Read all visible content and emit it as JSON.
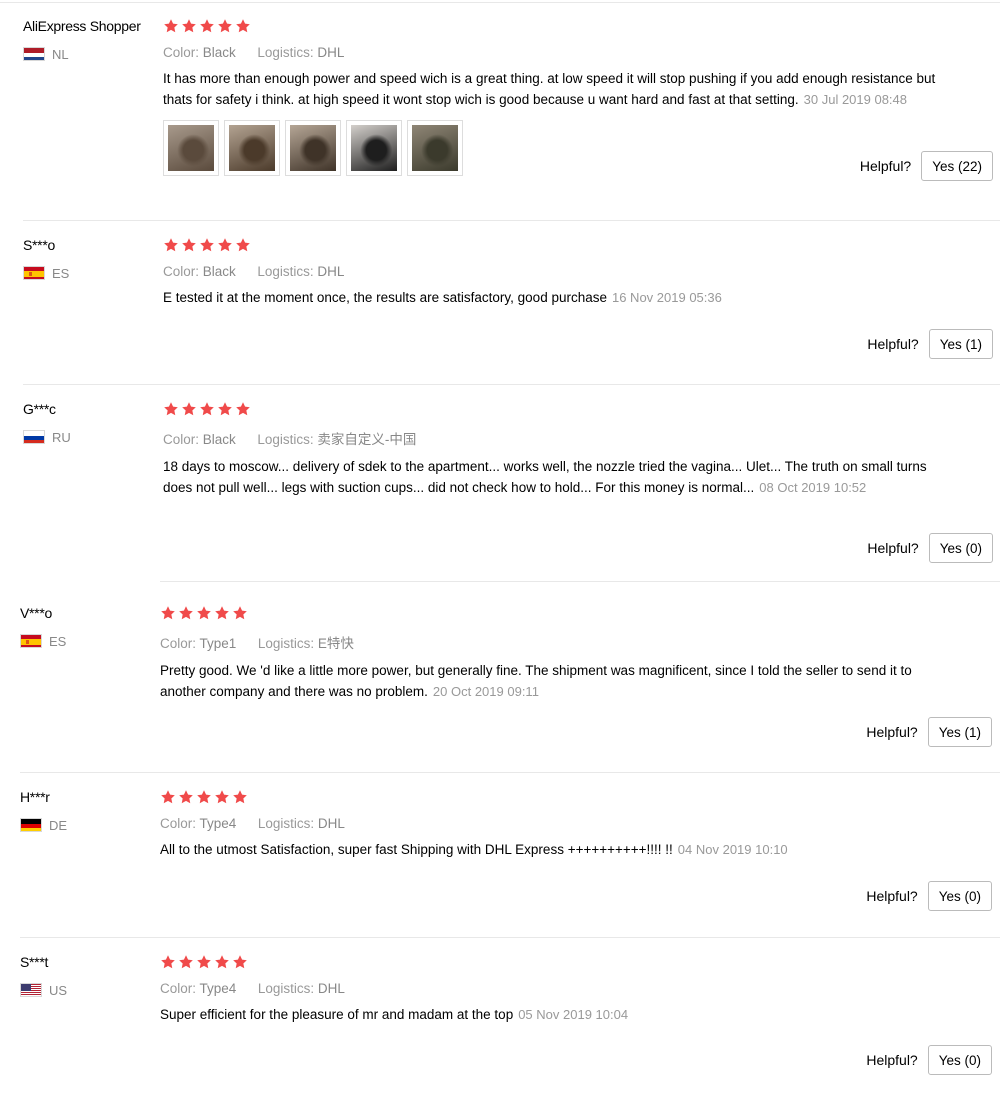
{
  "labels": {
    "color": "Color:",
    "logistics": "Logistics:",
    "helpful": "Helpful?"
  },
  "star_color": "#f04a4a",
  "reviews": [
    {
      "user": "AliExpress Shopper",
      "country": "NL",
      "rating": 5,
      "color": "Black",
      "logistics": "DHL",
      "text": "It has more than enough power and speed wich is a great thing. at low speed it will stop pushing if you add enough resistance but thats for safety i think. at high speed it wont stop wich is good because u want hard and fast at that setting.",
      "date": "30 Jul 2019 08:48",
      "photos": [
        "photo-1",
        "photo-2",
        "photo-3",
        "photo-4",
        "photo-5"
      ],
      "helpful": "Yes (22)"
    },
    {
      "user": "S***o",
      "country": "ES",
      "rating": 5,
      "color": "Black",
      "logistics": "DHL",
      "text": "E tested it at the moment once, the results are satisfactory, good purchase",
      "date": "16 Nov 2019 05:36",
      "helpful": "Yes (1)"
    },
    {
      "user": "G***c",
      "country": "RU",
      "rating": 5,
      "color": "Black",
      "logistics": "卖家自定义-中国",
      "text": "18 days to moscow... delivery of sdek to the apartment... works well, the nozzle tried the vagina... Ulet... The truth on small turns does not pull well... legs with suction cups... did not check how to hold... For this money is normal...",
      "date": "08 Oct 2019 10:52",
      "helpful": "Yes (0)"
    },
    {
      "user": "V***o",
      "country": "ES",
      "rating": 5,
      "color": "Type1",
      "logistics": "E特快",
      "text": "Pretty good. We 'd like a little more power, but generally fine. The shipment was magnificent, since I told the seller to send it to another company and there was no problem.",
      "date": "20 Oct 2019 09:11",
      "helpful": "Yes (1)"
    },
    {
      "user": "H***r",
      "country": "DE",
      "rating": 5,
      "color": "Type4",
      "logistics": "DHL",
      "text": "All to the utmost Satisfaction, super fast Shipping with DHL Express ++++++++++!!!! !!",
      "date": "04 Nov 2019 10:10",
      "helpful": "Yes (0)"
    },
    {
      "user": "S***t",
      "country": "US",
      "rating": 5,
      "color": "Type4",
      "logistics": "DHL",
      "text": "Super efficient for the pleasure of mr and madam at the top",
      "date": "05 Nov 2019 10:04",
      "helpful": "Yes (0)"
    }
  ]
}
